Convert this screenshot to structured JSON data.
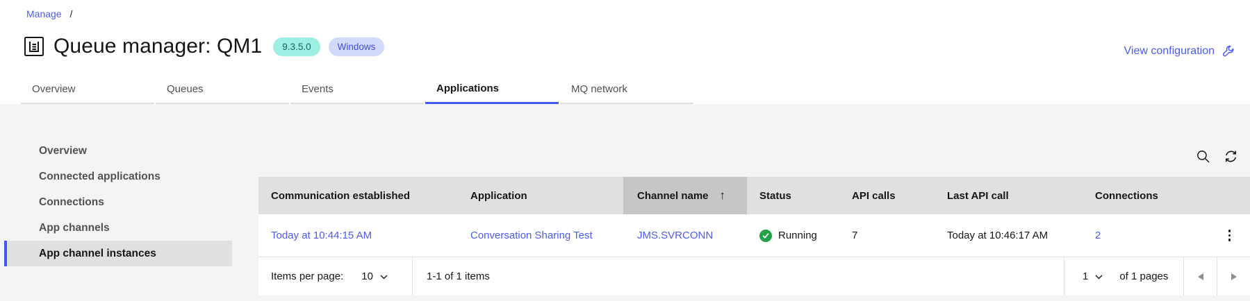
{
  "breadcrumb": {
    "link": "Manage",
    "separator": "/"
  },
  "page_header": {
    "title": "Queue manager: QM1",
    "version_badge": "9.3.5.0",
    "platform_badge": "Windows",
    "view_configuration_label": "View configuration"
  },
  "tabs": [
    {
      "label": "Overview",
      "active": false
    },
    {
      "label": "Queues",
      "active": false
    },
    {
      "label": "Events",
      "active": false
    },
    {
      "label": "Applications",
      "active": true
    },
    {
      "label": "MQ network",
      "active": false
    }
  ],
  "sidebar": {
    "items": [
      {
        "label": "Overview",
        "active": false
      },
      {
        "label": "Connected applications",
        "active": false
      },
      {
        "label": "Connections",
        "active": false
      },
      {
        "label": "App channels",
        "active": false
      },
      {
        "label": "App channel instances",
        "active": true
      }
    ]
  },
  "toolbar": {
    "icons": [
      "search-icon",
      "refresh-icon"
    ]
  },
  "table": {
    "columns": [
      "Communication established",
      "Application",
      "Channel name",
      "Status",
      "API calls",
      "Last API call",
      "Connections"
    ],
    "sort": {
      "column": "Channel name",
      "direction": "ascending",
      "arrow": "↑"
    },
    "rows": [
      {
        "communication_established": "Today at 10:44:15 AM",
        "application": "Conversation Sharing Test",
        "channel_name": "JMS.SVRCONN",
        "status": "Running",
        "api_calls": "7",
        "last_api_call": "Today at 10:46:17 AM",
        "connections": "2"
      }
    ]
  },
  "pagination": {
    "items_per_page_label": "Items per page:",
    "items_per_page_value": "10",
    "range_text": "1-1 of 1 items",
    "page_value": "1",
    "pages_text": "of 1 pages"
  },
  "colors": {
    "accent_blue": "#4357f2",
    "link_blue": "#4c5cf2",
    "teal_badge_bg": "#9deee3",
    "teal_badge_text": "#0d6a5e",
    "blue_badge_bg": "#d3d9fb",
    "blue_badge_text": "#4150d8",
    "status_green": "#24a148",
    "table_header_bg": "#e0e0e0",
    "sorted_header_bg": "#c6c6c6",
    "content_bg": "#f4f4f4"
  }
}
